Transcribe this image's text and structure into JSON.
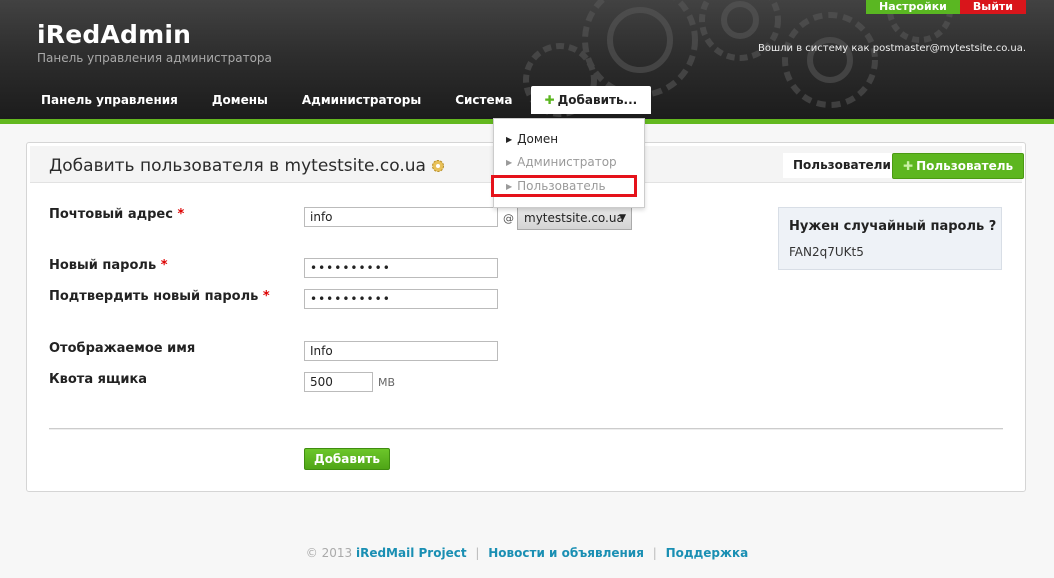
{
  "header": {
    "app_name": "iRedAdmin",
    "tagline": "Панель управления администратора",
    "settings_label": "Настройки",
    "logout_label": "Выйти",
    "login_info": "Вошли в систему как postmaster@mytestsite.co.ua."
  },
  "nav": {
    "items": [
      {
        "label": "Панель управления"
      },
      {
        "label": "Домены"
      },
      {
        "label": "Администраторы"
      },
      {
        "label": "Система"
      }
    ],
    "add_label": "Добавить..."
  },
  "dropdown": {
    "items": [
      {
        "label": "Домен"
      },
      {
        "label": "Администратор"
      },
      {
        "label": "Пользователь"
      }
    ]
  },
  "page": {
    "title": "Добавить пользователя в mytestsite.co.ua",
    "tab_users": "Пользователи",
    "tab_add_user": "Пользователь"
  },
  "form": {
    "email_label": "Почтовый адрес",
    "email_value": "info",
    "at": "@",
    "domain_value": "mytestsite.co.ua",
    "new_password_label": "Новый пароль",
    "new_password_value": "••••••••••",
    "confirm_password_label": "Подтвердить новый пароль",
    "confirm_password_value": "••••••••••",
    "display_name_label": "Отображаемое имя",
    "display_name_value": "Info",
    "quota_label": "Квота ящика",
    "quota_value": "500",
    "quota_unit": "MB",
    "required_mark": "*",
    "submit_label": "Добавить"
  },
  "random_password": {
    "title": "Нужен случайный пароль ?",
    "value": "FAN2q7UKt5"
  },
  "footer": {
    "copyright": "© 2013",
    "project_link": "iRedMail Project",
    "news_link": "Новости и объявления",
    "support_link": "Поддержка",
    "separator": "|"
  },
  "colors": {
    "accent_green": "#5db61f",
    "logout_red": "#d9151b",
    "highlight_red": "#e5121a",
    "link_blue": "#1a8fb3"
  }
}
